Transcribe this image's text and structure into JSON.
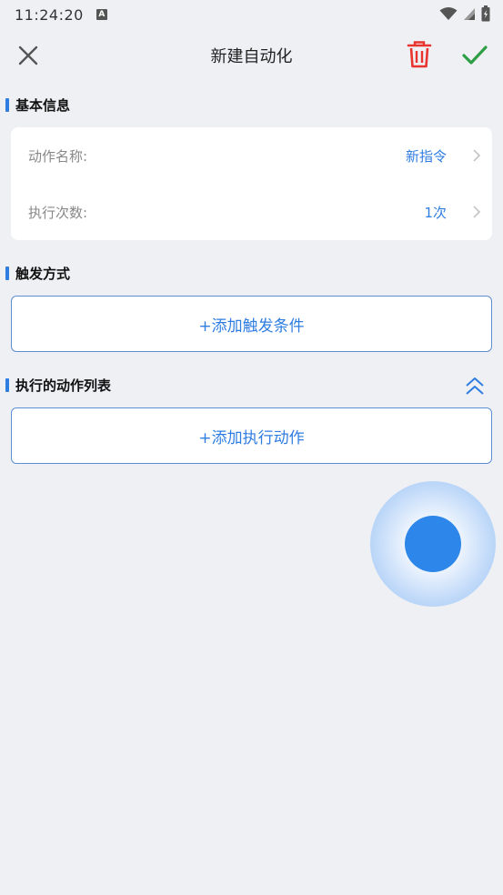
{
  "status_bar": {
    "time": "11:24:20",
    "notification_icon": "A"
  },
  "header": {
    "title": "新建自动化"
  },
  "basic_info": {
    "title": "基本信息",
    "rows": [
      {
        "label": "动作名称:",
        "value": "新指令"
      },
      {
        "label": "执行次数:",
        "value": "1次"
      }
    ]
  },
  "trigger": {
    "title": "触发方式",
    "add_label": "+添加触发条件"
  },
  "actions": {
    "title": "执行的动作列表",
    "add_label": "+添加执行动作"
  },
  "colors": {
    "accent": "#2f7de1",
    "delete": "#e8332f",
    "confirm": "#2e9e44",
    "background": "#eff0f4"
  },
  "icons": [
    "close-icon",
    "trash-icon",
    "check-icon",
    "chevron-right-icon",
    "double-chevron-up-icon",
    "wifi-icon",
    "signal-icon",
    "battery-icon"
  ]
}
